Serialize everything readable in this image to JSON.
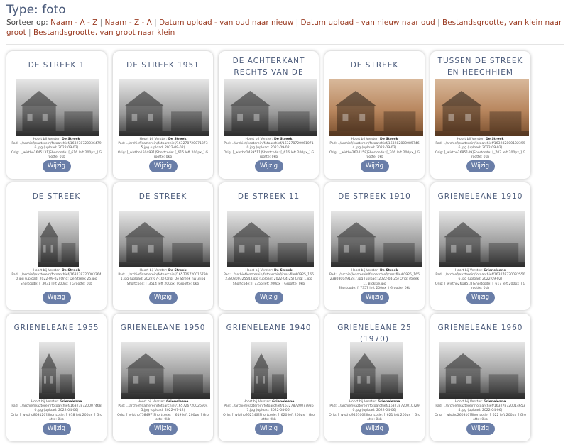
{
  "header": {
    "title": "Type: foto",
    "sort_label": "Sorteer op:",
    "sort_options": [
      "Naam - A - Z",
      "Naam - Z - A",
      "Datum upload - van oud naar nieuw",
      "Datum upload - van nieuw naar oud",
      "Bestandsgrootte, van klein naar groot",
      "Bestandsgrootte, van groot naar klein"
    ]
  },
  "colors": {
    "title": "#4a5a7a",
    "link": "#9a3b22",
    "button": "#6a7ea8"
  },
  "cards": [
    {
      "title": "De streek 1",
      "tone": "gray",
      "meta1": "Hoort bij Verster:",
      "meta1b": "De Streek",
      "meta2": "Pad: ../archief/eazterein/fotoarchief/1632787200364796.jpg (upload: 2022-09-02)",
      "meta3": "Orig: [_wistho1645131]Shortcode: [_616 left 200px_] Grootte: 0kb",
      "button": "Wijzig"
    },
    {
      "title": "De streek 1951",
      "tone": "gray",
      "meta1": "Hoort bij Verster:",
      "meta1b": "De Streek",
      "meta2": "Pad: ../archief/eazterein/fotoarchief/1632787200713735.jpg (upload: 2022-09-02)",
      "meta3": "Orig: [_wistho1504931]Shortcode: [_615 left 200px_] Grootte: 0kb",
      "button": "Wijzig"
    },
    {
      "title": "De achterkant rechts van de streek",
      "tone": "gray",
      "meta1": "Hoort bij Verster:",
      "meta1b": "De Streek",
      "meta2": "Pad: ../archief/eazterein/fotoarchief/1632787200610710.jpg (upload: 2022-09-02)",
      "meta3": "Orig: [_wistho1459511]Shortcode: [_616 left 200px_] Grootte: 0kb",
      "button": "Wijzig"
    },
    {
      "title": "De streek",
      "tone": "sepia",
      "meta1": "Hoort bij Verster:",
      "meta1b": "De Streek",
      "meta2": "Pad: ../archief/eazterein/fotoarchief/1632828000857464.jpg (upload: 2022-09-02)",
      "meta3": "Orig: [_wistho2624158]Shortcode: [_706 left 200px_] Grootte: 0kb",
      "button": "Wijzig"
    },
    {
      "title": "Tussen de streek en Heechhiem",
      "tone": "sepia",
      "meta1": "Hoort bij Verster:",
      "meta1b": "De Streek",
      "meta2": "Pad: ../archief/eazterein/fotoarchief/1632828001023996.jpg (upload: 2022-09-02)",
      "meta3": "Orig: [_wistho2685149]Shortcode: [_707 left 200px_] Grootte: 0kb",
      "button": "Wijzig"
    },
    {
      "title": "De streek",
      "tone": "gray",
      "meta1": "Hoort bij Verster:",
      "meta1b": "De Streek",
      "meta2": "Pad: ../archief/eazterein/fotoarchief/1632787200032640.jpg (upload: 2022-09-02) Orig: De Streek 25.jpg",
      "meta3": "Shortcode: [_3031 left 200px_] Grootte: 0kb",
      "button": "Wijzig"
    },
    {
      "title": "De streek",
      "tone": "gray",
      "meta1": "Hoort bij Verster:",
      "meta1b": "De Streek",
      "meta2": "Pad: ../archief/eazterein/fotoarchief/1657267200157901.jpg (upload: 2022-07-10) Orig: De Streek nw 3.jpg",
      "meta3": "Shortcode: [_3514 left 200px_] Grootte: 0kb",
      "button": "Wijzig"
    },
    {
      "title": "De streek 11",
      "tone": "gray",
      "meta1": "Hoort bij Verster:",
      "meta1b": "De Streek",
      "meta2": "Pad: ../archief/eazterein/fotoarchief/cms-file#0925_1652380800325543.jpg (upload: 2022-04-25) Orig: 1.jpg",
      "meta3": "Shortcode: [_7356 left 200px_] Grootte: 0kb",
      "button": "Wijzig"
    },
    {
      "title": "De streek 1910",
      "tone": "gray",
      "meta1": "Hoort bij Verster:",
      "meta1b": "De Streek",
      "meta2": "Pad: ../archief/eazterein/fotoarchief/cms-file#0925_1652380800491247.jpg (upload: 2022-04-25) Orig: streek 11 Blokkie.jpg",
      "meta3": "Shortcode: [_7357 left 200px_] Grootte: 0kb",
      "button": "Wijzig"
    },
    {
      "title": "Grieneleane 1910",
      "tone": "gray",
      "meta1": "Hoort bij Verster:",
      "meta1b": "Grieneleane",
      "meta2": "Pad: ../archief/eazterein/fotoarchief/1632787200325506.jpg (upload: 2022-09-02)",
      "meta3": "Orig: [_wistho2618518]Shortcode: [_617 left 200px_] Grootte: 0kb",
      "button": "Wijzig"
    },
    {
      "title": "Grieneleane 1955",
      "tone": "gray",
      "meta1": "Hoort bij Verster:",
      "meta1b": "Grieneleane",
      "meta2": "Pad: ../archief/eazterein/fotoarchief/1632787200074680.jpg (upload: 2022-04-06)",
      "meta3": "Orig: [_wistho803120]Shortcode: [_618 left 200px_] Grootte: 0kb",
      "button": "Wijzig"
    },
    {
      "title": "Grieneleane 1950",
      "tone": "gray",
      "meta1": "Hoort bij Verster:",
      "meta1b": "Grieneleane",
      "meta2": "Pad: ../archief/eazterein/fotoarchief/1657267200269045.jpg (upload: 2022-07-12)",
      "meta3": "Orig: [_wistho758497]Shortcode: [_619 left 200px_] Grootte: 0kb",
      "button": "Wijzig"
    },
    {
      "title": "Grieneleane 1940",
      "tone": "gray",
      "meta1": "Hoort bij Verster:",
      "meta1b": "Grieneleane",
      "meta2": "Pad: ../archief/eazterein/fotoarchief/1632787200779367.jpg (upload: 2022-04-06)",
      "meta3": "Orig: [_wistho962146]Shortcode: [_620 left 200px_] Grootte: 0kb",
      "button": "Wijzig"
    },
    {
      "title": "Grieneleane 25 (1970)",
      "tone": "gray",
      "meta1": "Hoort bij Verster:",
      "meta1b": "Grieneleane",
      "meta2": "Pad: ../archief/eazterein/fotoarchief/1632787200107290.jpg (upload: 2022-04-06)",
      "meta3": "Orig: [_wistho946100]Shortcode: [_621 left 200px_] Grootte: 0kb",
      "button": "Wijzig"
    },
    {
      "title": "Grieneleane 1960",
      "tone": "gray",
      "meta1": "Hoort bij Verster:",
      "meta1b": "Grieneleane",
      "meta2": "Pad: ../archief/eazterein/fotoarchief/1632787200146534.jpg (upload: 2022-04-06)",
      "meta3": "Orig: [_wistho260310]Shortcode: [_622 left 200px_] Grootte: 0kb",
      "button": "Wijzig"
    }
  ]
}
